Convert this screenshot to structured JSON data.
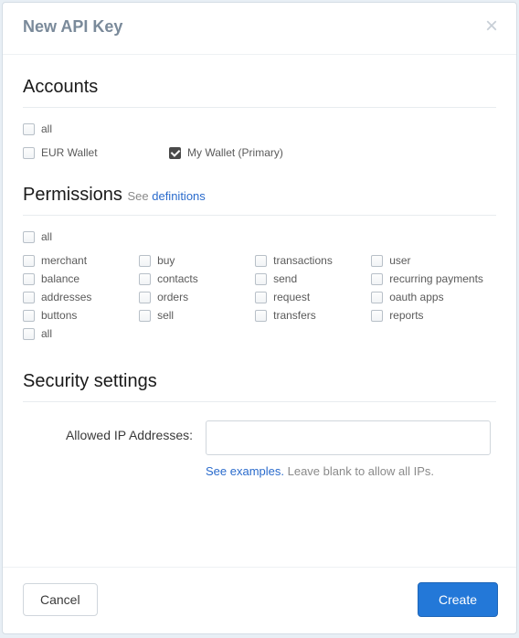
{
  "modal": {
    "title": "New API Key",
    "cancel_label": "Cancel",
    "create_label": "Create"
  },
  "accounts": {
    "title": "Accounts",
    "all_label": "all",
    "items": [
      {
        "label": "EUR Wallet",
        "checked": false
      },
      {
        "label": "My Wallet (Primary)",
        "checked": true
      }
    ]
  },
  "permissions": {
    "title": "Permissions",
    "see_text": "See ",
    "definitions_link": "definitions",
    "all_label": "all",
    "columns": [
      [
        "merchant",
        "balance",
        "addresses",
        "buttons",
        "all"
      ],
      [
        "buy",
        "contacts",
        "orders",
        "sell"
      ],
      [
        "transactions",
        "send",
        "request",
        "transfers"
      ],
      [
        "user",
        "recurring payments",
        "oauth apps",
        "reports"
      ]
    ]
  },
  "security": {
    "title": "Security settings",
    "ip_label": "Allowed IP Addresses:",
    "ip_value": "",
    "examples_link": "See examples.",
    "hint_text": " Leave blank to allow all IPs."
  }
}
